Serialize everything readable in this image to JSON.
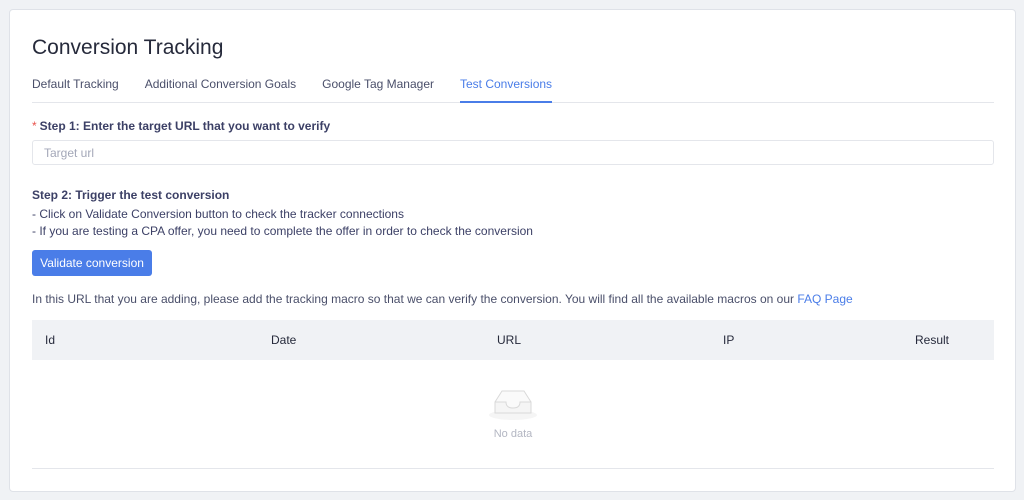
{
  "page": {
    "title": "Conversion Tracking"
  },
  "tabs": [
    {
      "label": "Default Tracking",
      "active": false
    },
    {
      "label": "Additional Conversion Goals",
      "active": false
    },
    {
      "label": "Google Tag Manager",
      "active": false
    },
    {
      "label": "Test Conversions",
      "active": true
    }
  ],
  "step1": {
    "required_mark": "*",
    "label": "Step 1: Enter the target URL that you want to verify",
    "input_placeholder": "Target url",
    "input_value": ""
  },
  "step2": {
    "label": "Step 2: Trigger the test conversion",
    "lines": [
      "- Click on Validate Conversion button to check the tracker connections",
      "- If you are testing a CPA offer, you need to complete the offer in order to check the conversion"
    ],
    "button_label": "Validate conversion"
  },
  "note": {
    "text": "In this URL that you are adding, please add the tracking macro so that we can verify the conversion. You will find all the available macros on our ",
    "link_label": "FAQ Page"
  },
  "table": {
    "columns": [
      "Id",
      "Date",
      "URL",
      "IP",
      "Result"
    ],
    "rows": [],
    "empty_text": "No data",
    "empty_icon": "empty-inbox-icon"
  },
  "colors": {
    "accent": "#4a7de8",
    "required": "#e8534c",
    "header_bg": "#f0f2f5"
  }
}
